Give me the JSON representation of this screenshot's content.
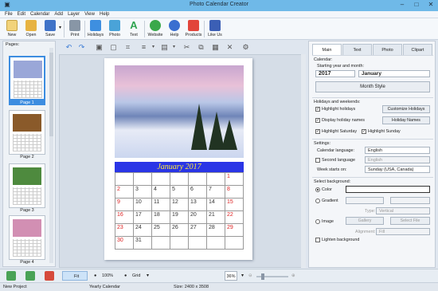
{
  "window": {
    "title": "Photo Calendar Creator"
  },
  "menu": [
    "File",
    "Edit",
    "Calendar",
    "Add",
    "Layer",
    "View",
    "Help"
  ],
  "ribbon": [
    {
      "label": "New",
      "icon": "new-icon",
      "color": "#e8b84a"
    },
    {
      "label": "Open",
      "icon": "open-folder-icon",
      "color": "#e7b341"
    },
    {
      "label": "Save",
      "icon": "save-icon",
      "color": "#3f73c8"
    },
    {
      "label": "Print",
      "icon": "print-icon",
      "color": "#6a7a8c"
    },
    {
      "label": "Holidays",
      "icon": "holidays-icon",
      "color": "#3e8fe0"
    },
    {
      "label": "Photo",
      "icon": "photo-icon",
      "color": "#4aa3d8"
    },
    {
      "label": "Text",
      "icon": "text-icon",
      "color": "#2ea44f"
    },
    {
      "label": "Website",
      "icon": "website-icon",
      "color": "#3aa84a"
    },
    {
      "label": "Help",
      "icon": "help-icon",
      "color": "#3a6fd0"
    },
    {
      "label": "Products",
      "icon": "products-icon",
      "color": "#e2443b"
    },
    {
      "label": "Like Us",
      "icon": "like-icon",
      "color": "#3b5fb5"
    }
  ],
  "pages": {
    "header": "Pages:",
    "items": [
      {
        "label": "Page 1",
        "color": "#9aa7d8"
      },
      {
        "label": "Page 2",
        "color": "#8a5a2a"
      },
      {
        "label": "Page 3",
        "color": "#4e8a3e"
      },
      {
        "label": "Page 4",
        "color": "#d28fb3"
      }
    ]
  },
  "calendar": {
    "month_title": "January 2017",
    "rows": [
      [
        "",
        "",
        "",
        "",
        "",
        "",
        "1"
      ],
      [
        "2",
        "3",
        "4",
        "5",
        "6",
        "7",
        "8"
      ],
      [
        "9",
        "10",
        "11",
        "12",
        "13",
        "14",
        "15"
      ],
      [
        "16",
        "17",
        "18",
        "19",
        "20",
        "21",
        "22"
      ],
      [
        "23",
        "24",
        "25",
        "26",
        "27",
        "28",
        "29"
      ],
      [
        "30",
        "31",
        "",
        "",
        "",
        "",
        ""
      ]
    ]
  },
  "right_panel": {
    "tabs": [
      "Main",
      "Text",
      "Photo",
      "Clipart"
    ],
    "calendar_group": "Calendar:",
    "start_label": "Starting year and month:",
    "year": "2017",
    "month": "January",
    "month_style_btn": "Month Style",
    "holidays_group": "Holidays and weekends:",
    "highlight_holidays": "Highlight holidays",
    "display_holiday_names": "Display holiday names",
    "highlight_saturday": "Highlight Saturday",
    "highlight_sunday": "Highlight Sunday",
    "customize_holidays_btn": "Customize Holidays",
    "holiday_names_btn": "Holiday Names",
    "settings_group": "Settings:",
    "calendar_language_label": "Calendar language:",
    "calendar_language": "English",
    "second_language_label": "Second language",
    "second_language": "English",
    "week_starts_label": "Week starts on:",
    "week_starts": "Sunday (USA, Canada)",
    "background_group": "Select background:",
    "color_label": "Color",
    "gradient_label": "Gradient",
    "type_label": "Type:",
    "type_value": "Vertical",
    "image_label": "Image",
    "gallery_btn": "Gallery",
    "select_file_btn": "Select File",
    "alignment_label": "Alignment:",
    "alignment_value": "Fill",
    "lighten_label": "Lighten background"
  },
  "bottom": {
    "fit": "Fit",
    "zoom_pct": "100%",
    "grid": "Grid",
    "zoom_field": "36%"
  },
  "status": {
    "project": "New Project",
    "calendar_type": "Yearly Calendar",
    "size": "Size: 2400 x 3508"
  }
}
